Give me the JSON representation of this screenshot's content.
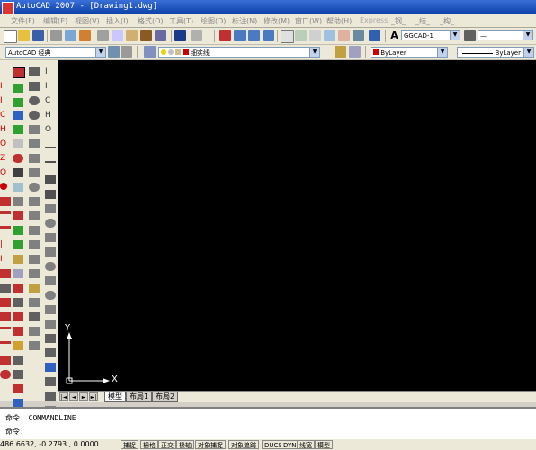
{
  "window": {
    "title": "AutoCAD 2007 - [Drawing1.dwg]"
  },
  "menu": [
    "文件(F)",
    "编辑(E)",
    "视图(V)",
    "插入(I)",
    "格式(O)",
    "工具(T)",
    "绘图(D)",
    "标注(N)",
    "修改(M)",
    "窗口(W)",
    "帮助(H)",
    "Express",
    "_钢_",
    "_结_",
    "_构_"
  ],
  "toolbar": {
    "textstyle": "GGCAD-1",
    "dimstyle": "—",
    "workspace": "AutoCAD 经典",
    "layer": "细实线",
    "color": "ByLayer",
    "linetype": "ByLayer"
  },
  "tabs": [
    "模型",
    "布局1",
    "布局2"
  ],
  "nav": [
    "|◄",
    "◄",
    "►",
    "►|"
  ],
  "command": {
    "line1": "命令: COMMANDLINE",
    "line2": "命令:"
  },
  "status": {
    "coords": "486.6632, -0.2793 , 0.0000",
    "buttons": [
      "捕捉",
      "栅格",
      "正交",
      "极轴",
      "对象捕捉",
      "对象追踪",
      "DUCS",
      "DYN",
      "线宽",
      "模型"
    ]
  },
  "ucs": {
    "x_label": "X",
    "y_label": "Y"
  },
  "colors": {
    "canvas": "#000000",
    "title_bar": "#0a3fa8",
    "layer_swatch": "#cc0000"
  }
}
